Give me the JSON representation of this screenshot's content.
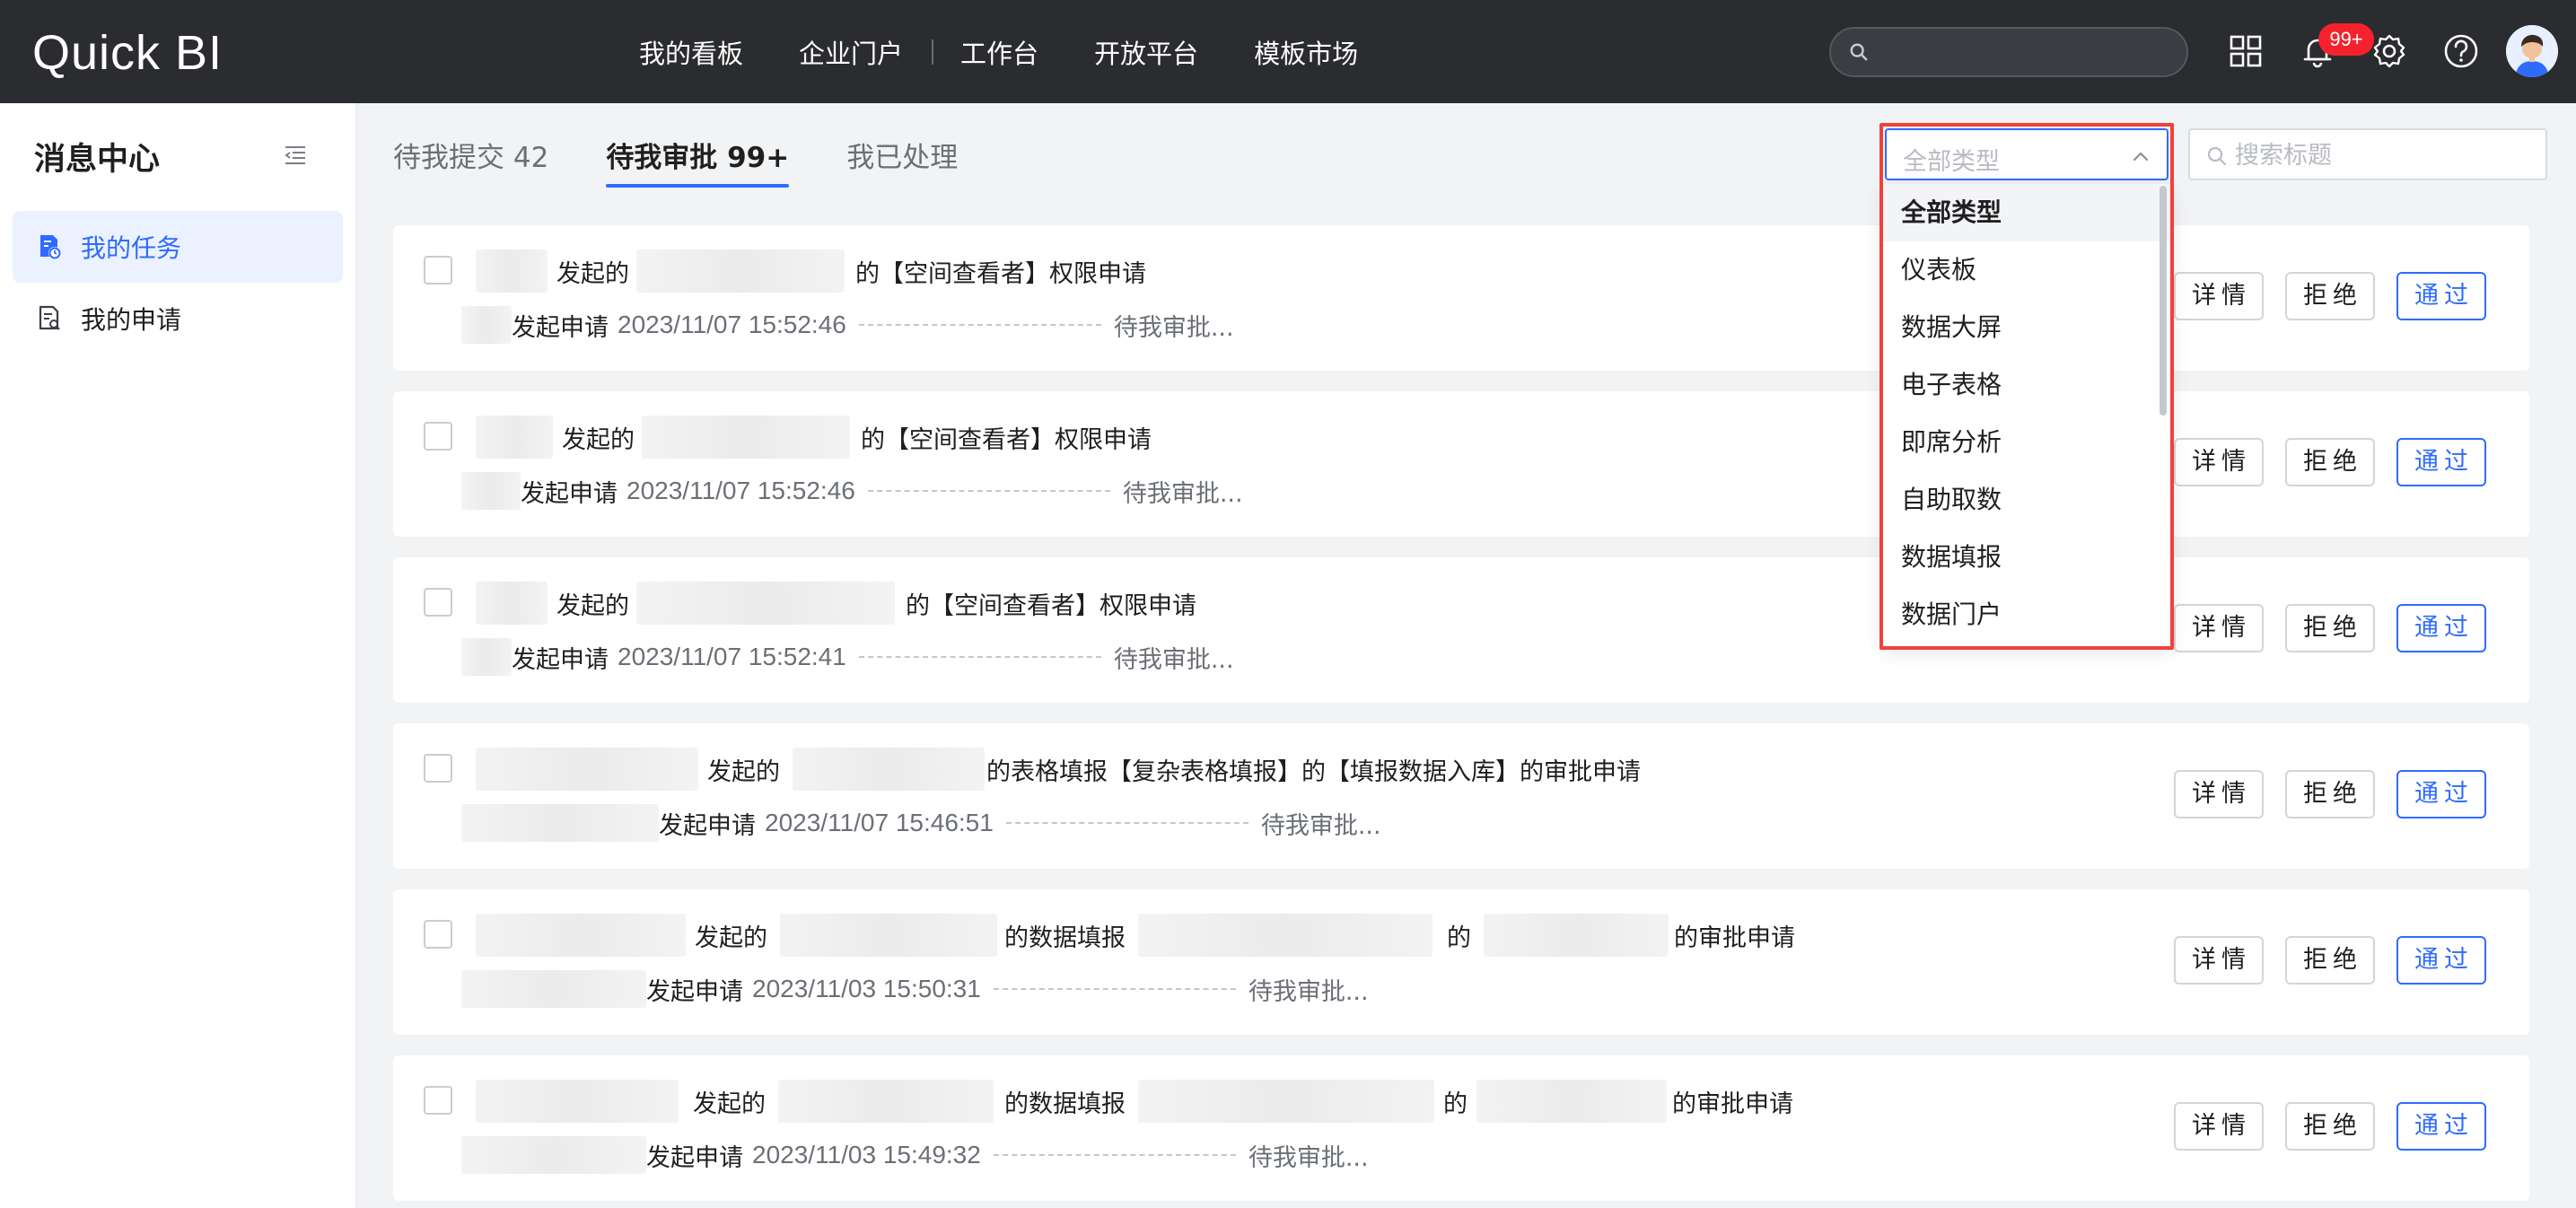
{
  "app": {
    "logo": "Quick BI"
  },
  "topnav": {
    "items": [
      "我的看板",
      "企业门户",
      "工作台",
      "开放平台",
      "模板市场"
    ],
    "notification_badge": "99+"
  },
  "sidebar": {
    "title": "消息中心",
    "items": [
      {
        "label": "我的任务",
        "active": true
      },
      {
        "label": "我的申请",
        "active": false
      }
    ]
  },
  "tabs": [
    {
      "label": "待我提交 42",
      "active": false
    },
    {
      "label": "待我审批 99+",
      "active": true
    },
    {
      "label": "我已处理",
      "active": false
    }
  ],
  "filters": {
    "type_placeholder": "全部类型",
    "search_placeholder": "搜索标题"
  },
  "dropdown": {
    "options": [
      "全部类型",
      "仪表板",
      "数据大屏",
      "电子表格",
      "即席分析",
      "自助取数",
      "数据填报",
      "数据门户"
    ],
    "selected": "全部类型"
  },
  "actions": {
    "detail": "详情",
    "reject": "拒绝",
    "approve": "通过"
  },
  "tasks": [
    {
      "initiated": "发起的",
      "subject": "的【空间查看者】权限申请",
      "apply": "发起申请",
      "time": "2023/11/07 15:52:46",
      "status": "待我审批..."
    },
    {
      "initiated": "发起的",
      "subject": "的【空间查看者】权限申请",
      "apply": "发起申请",
      "time": "2023/11/07 15:52:46",
      "status": "待我审批..."
    },
    {
      "initiated": "发起的",
      "subject": "的【空间查看者】权限申请",
      "apply": "发起申请",
      "time": "2023/11/07 15:52:41",
      "status": "待我审批..."
    },
    {
      "initiated": "发起的",
      "subject": "的表格填报【复杂表格填报】的【填报数据入库】的审批申请",
      "apply": "发起申请",
      "time": "2023/11/07 15:46:51",
      "status": "待我审批..."
    },
    {
      "initiated": "发起的",
      "subject": "的数据填报",
      "mid": "的",
      "tail": "的审批申请",
      "apply": "发起申请",
      "time": "2023/11/03 15:50:31",
      "status": "待我审批..."
    },
    {
      "initiated": "发起的",
      "subject": "的数据填报",
      "mid": "的",
      "tail": "的审批申请",
      "apply": "发起申请",
      "time": "2023/11/03 15:49:32",
      "status": "待我审批..."
    }
  ],
  "colors": {
    "accent": "#2f6bff",
    "topbar": "#2b2c2f",
    "badge": "#f5222d",
    "highlight": "#f0413c"
  }
}
